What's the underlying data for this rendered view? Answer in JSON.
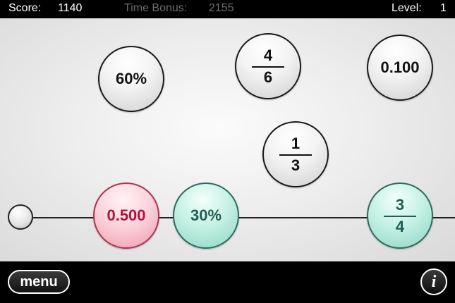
{
  "hud": {
    "score_label": "Score:",
    "score_value": "1140",
    "time_bonus_label": "Time Bonus:",
    "time_bonus_value": "2155",
    "level_label": "Level:",
    "level_value": "1"
  },
  "falling_bubbles": {
    "percent_60": "60%",
    "fraction_4_6": {
      "numerator": "4",
      "denominator": "6"
    },
    "decimal_0_100": "0.100",
    "fraction_1_3": {
      "numerator": "1",
      "denominator": "3"
    }
  },
  "track_bubbles": {
    "decimal_0_500": "0.500",
    "percent_30": "30%",
    "fraction_3_4": {
      "numerator": "3",
      "denominator": "4"
    }
  },
  "controls": {
    "menu_label": "menu",
    "info_label": "i"
  },
  "colors": {
    "neutral_bubble": "#e6e6e6",
    "pink_bubble": "#f5b7c5",
    "pink_text": "#b0133c",
    "teal_bubble": "#b3e8d9",
    "teal_text": "#1f5d55",
    "bar_background": "#000000",
    "dimmed_hud_text": "#6e6e6e"
  }
}
